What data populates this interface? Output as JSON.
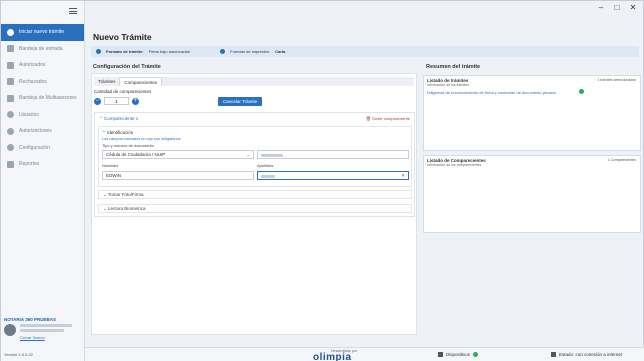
{
  "window": {
    "minimize": "–",
    "maximize": "□",
    "close": "✕"
  },
  "sidebar": {
    "items": [
      {
        "label": "Iniciar nuevo trámite",
        "icon": "plus-circle-icon",
        "active": true
      },
      {
        "label": "Bandeja de entrada",
        "icon": "inbox-icon"
      },
      {
        "label": "Autorizados",
        "icon": "document-icon"
      },
      {
        "label": "Rechazados",
        "icon": "document-rejected-icon"
      },
      {
        "label": "Bandeja de Multiasesores",
        "icon": "document-group-icon"
      },
      {
        "label": "Usuarios",
        "icon": "user-icon"
      },
      {
        "label": "Autorizaciones",
        "icon": "key-icon"
      },
      {
        "label": "Configuración",
        "icon": "gear-icon"
      },
      {
        "label": "Reportes",
        "icon": "chart-icon"
      }
    ],
    "notaria": "NOTARIA 360 PRUEBAS",
    "logout": "Cerrar Sesión",
    "version": "Versión 1.0.0.22"
  },
  "main": {
    "title": "Nuevo Trámite",
    "infobar": {
      "formato_tramite_label": "Formato de trámite:",
      "formato_tramite_value": "Firma bajo autorización",
      "formato_impresion_label": "Formato de impresión:",
      "formato_impresion_value": "Carta"
    }
  },
  "config": {
    "title": "Configuración del Trámite",
    "tabs": [
      "Trámites",
      "Comparecientes"
    ],
    "cantidad_label": "Cantidad de comparecientes",
    "cantidad_value": "1",
    "cancel_button": "Cancelar Trámite",
    "compareciente": {
      "header": "Compareciente 1",
      "remove": "Omitir compareciente",
      "identificacion": "Identificación",
      "required_note": "Los campos marcados en rojo son obligatorios",
      "tipo_doc_label": "Tipo y número de documento",
      "tipo_doc_value": "Cédula de Ciudadanía / NUIP",
      "nombres_label": "Nombres",
      "nombres_value": "EDWIN",
      "apellidos_label": "Apellidos",
      "sections": [
        "Tomar Foto/Firma",
        "Lectura Biometrica"
      ]
    }
  },
  "summary": {
    "title": "Resumen del trámite",
    "tramites": {
      "title": "Listado de trámites",
      "subtitle": "Información de los trámites",
      "count": "1 trámites seleccionados",
      "item": "Diligencia de reconocimiento de firma y contenido de documento privado"
    },
    "comparecientes": {
      "title": "Listado de Comparecientes",
      "subtitle": "Información de los comparecientes",
      "count": "1 Comparecientes"
    }
  },
  "footer": {
    "developed_by": "Desarrollado por",
    "brand": "olimpia",
    "dispositivos": "Dispositivos",
    "network": "Estado: con conexión a internet"
  }
}
